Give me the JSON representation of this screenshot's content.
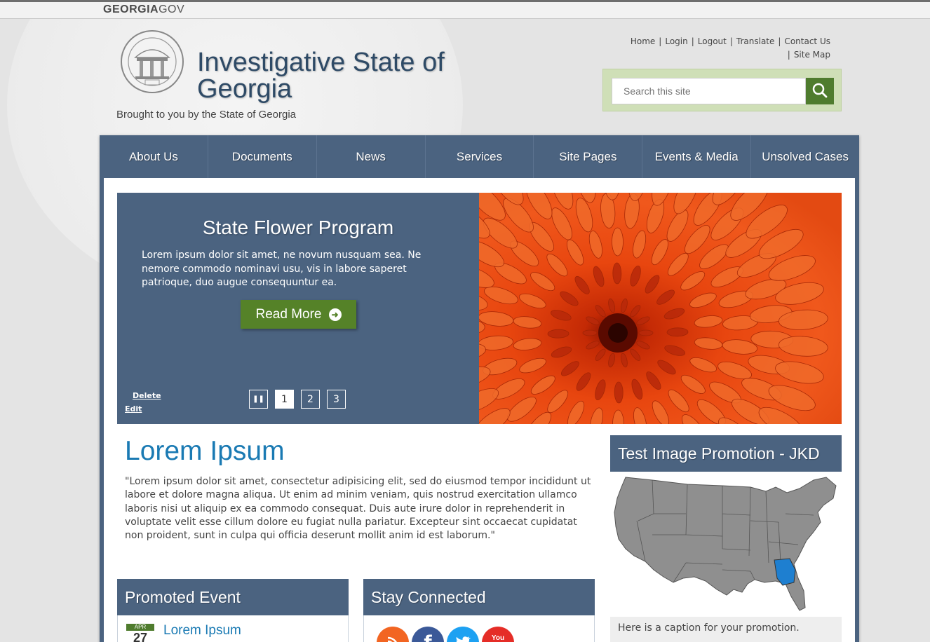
{
  "topbar": {
    "brand_bold": "GEORGIA",
    "brand_light": "GOV"
  },
  "header": {
    "title": "Investigative State of Georgia",
    "tagline": "Brought to you by the State of Georgia",
    "seal_alt": "State of Georgia seal",
    "util_links": [
      "Home",
      "Login",
      "Logout",
      "Translate",
      "Contact Us",
      "Site Map"
    ],
    "search": {
      "placeholder": "Search this site",
      "value": ""
    }
  },
  "nav": {
    "items": [
      "About Us",
      "Documents",
      "News",
      "Services",
      "Site Pages",
      "Events & Media",
      "Unsolved Cases"
    ]
  },
  "hero": {
    "title": "State Flower Program",
    "text": "Lorem ipsum dolor sit amet, ne novum nusquam sea. Ne nemore commodo nominavi usu, vis in labore saperet patrioque, duo augue consequuntur ea.",
    "button": "Read More",
    "admin_delete": "Delete",
    "admin_edit": "Edit",
    "pages": [
      "1",
      "2",
      "3"
    ],
    "active_page": "1"
  },
  "main": {
    "heading": "Lorem Ipsum",
    "body": "\"Lorem ipsum dolor sit amet, consectetur adipisicing elit, sed do eiusmod tempor incididunt ut labore et dolore magna aliqua. Ut enim ad minim veniam, quis nostrud exercitation ullamco laboris nisi ut aliquip ex ea commodo consequat. Duis aute irure dolor in reprehenderit in voluptate velit esse cillum dolore eu fugiat nulla pariatur. Excepteur sint occaecat cupidatat non proident, sunt in culpa qui officia deserunt mollit anim id est laborum.\""
  },
  "promoted_event": {
    "heading": "Promoted Event",
    "month": "APR",
    "day": "27",
    "title": "Lorem Ipsum"
  },
  "stay_connected": {
    "heading": "Stay Connected",
    "youtube_text": "You"
  },
  "promotion": {
    "heading": "Test Image Promotion - JKD",
    "caption": "Here is a caption for your promotion."
  },
  "colors": {
    "nav_bg": "#4b6380",
    "accent_green": "#558228",
    "link_blue": "#1a7ab3",
    "search_bg": "#cfdfb7",
    "highlight_state": "#1e7fd0"
  }
}
